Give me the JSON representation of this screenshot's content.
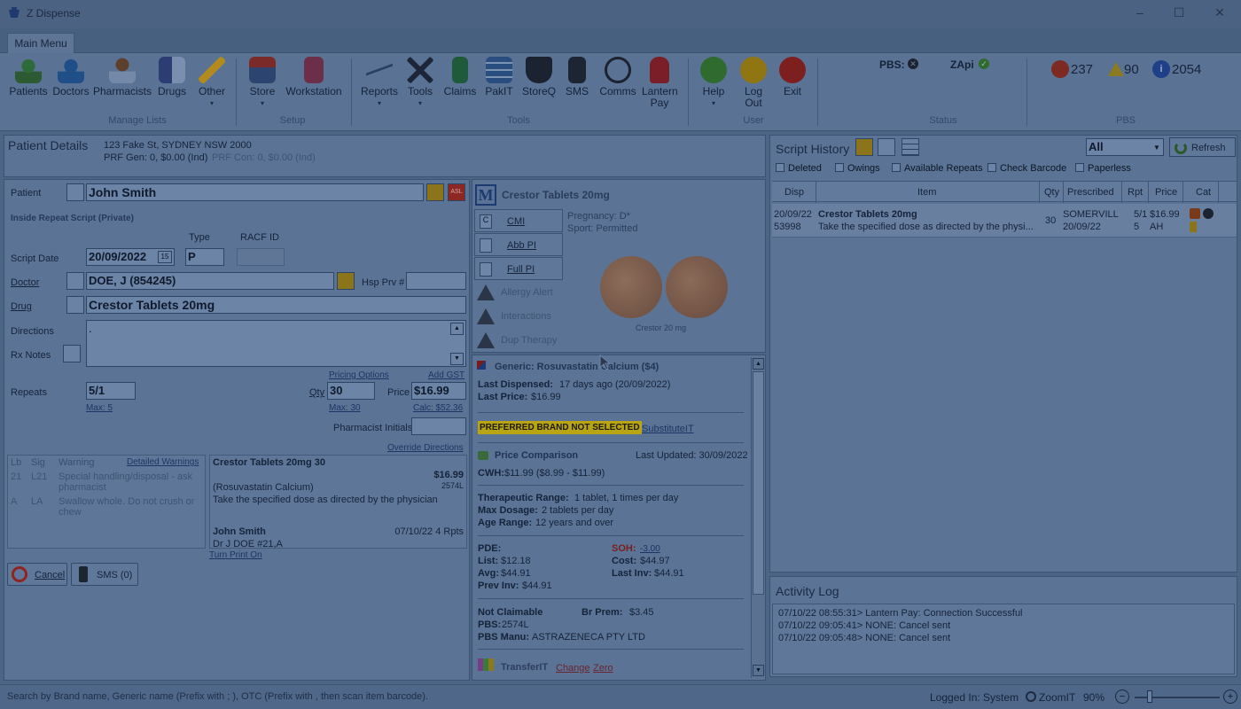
{
  "window": {
    "title": "Z Dispense"
  },
  "ribbon": {
    "tab": "Main Menu",
    "buttons": [
      "Patients",
      "Doctors",
      "Pharmacists",
      "Drugs",
      "Other",
      "Store",
      "Workstation",
      "Reports",
      "Tools",
      "Claims",
      "PakIT",
      "StoreQ",
      "SMS",
      "Comms",
      "Lantern Pay",
      "Help",
      "Log Out",
      "Exit"
    ],
    "groups": [
      "Manage Lists",
      "Setup",
      "Tools",
      "User",
      "Status",
      "PBS"
    ],
    "status": {
      "pbs": "PBS:",
      "zapi": "ZApi"
    },
    "pbs_counts": [
      "237",
      "90",
      "2054"
    ]
  },
  "patient_details": {
    "title": "Patient Details",
    "address": "123 Fake St, SYDNEY NSW 2000",
    "prf_gen": "PRF Gen: 0, $0.00 (Ind)",
    "prf_con": "PRF Con: 0, $0.00 (Ind)"
  },
  "form": {
    "patient_label": "Patient",
    "patient": "John Smith",
    "script_type": "Inside Repeat Script (Private)",
    "type_label": "Type",
    "racf_label": "RACF ID",
    "script_date_label": "Script Date",
    "script_date": "20/09/2022",
    "type": "P",
    "doctor_label": "Doctor",
    "doctor": "DOE, J    (854245)",
    "hsp_label": "Hsp Prv #",
    "drug_label": "Drug",
    "drug": "Crestor Tablets 20mg",
    "directions_label": "Directions",
    "directions": ".",
    "rx_notes_label": "Rx Notes",
    "pricing_options": "Pricing Options",
    "add_gst": "Add GST",
    "repeats_label": "Repeats",
    "repeats": "5/1",
    "max_repeats": "Max: 5",
    "qty_label": "Qty",
    "qty": "30",
    "max_qty": "Max: 30",
    "price_label": "Price",
    "price": "$16.99",
    "calc": "Calc: $52.36",
    "pharmacist_initials_label": "Pharmacist Initials",
    "override_directions": "Override Directions"
  },
  "warnings": {
    "headers": [
      "Lb",
      "Sig",
      "Warning"
    ],
    "detailed": "Detailed Warnings",
    "rows": [
      [
        "21",
        "L21",
        "Special handling/disposal - ask pharmacist"
      ],
      [
        "A",
        "LA",
        "Swallow whole. Do not crush or chew"
      ]
    ]
  },
  "label_preview": {
    "drug": "Crestor Tablets 20mg 30",
    "price": "$16.99",
    "code": "2574L",
    "generic": "(Rosuvastatin Calcium)",
    "directions": "Take the specified dose as directed by the physician",
    "patient": "John Smith",
    "date_rpts": "07/10/22 4 Rpts",
    "doctor": "Dr J DOE  #21,A",
    "turn_print": "Turn Print On"
  },
  "bottom_buttons": {
    "cancel": "Cancel",
    "sms": "SMS (0)"
  },
  "drug_info": {
    "title": "Crestor Tablets 20mg",
    "logo": "M",
    "side_buttons": [
      "CMI",
      "Abb PI",
      "Full PI",
      "Allergy Alert",
      "Interactions",
      "Dup Therapy"
    ],
    "pregnancy": "Pregnancy: D*",
    "sport": "Sport: Permitted",
    "pill_caption": "Crestor 20 mg",
    "generic": "Generic: Rosuvastatin Calcium ($4)",
    "last_dispensed_label": "Last Dispensed:",
    "last_dispensed": "17 days ago (20/09/2022)",
    "last_price_label": "Last Price:",
    "last_price": "$16.99",
    "preferred": "PREFERRED BRAND NOT SELECTED",
    "substitute": "SubstituteIT",
    "price_comparison": "Price Comparison",
    "last_updated": "Last Updated: 30/09/2022",
    "cwh_label": "CWH:",
    "cwh": "$11.99 ($8.99 - $11.99)",
    "therapeutic_label": "Therapeutic Range:",
    "therapeutic": "1 tablet, 1 times per day",
    "max_dosage_label": "Max Dosage:",
    "max_dosage": "2 tablets per day",
    "age_label": "Age Range:",
    "age": "12 years and over",
    "pde": "PDE:",
    "soh_label": "SOH:",
    "soh": "-3.00",
    "list_label": "List:",
    "list": "$12.18",
    "cost_label": "Cost:",
    "cost": "$44.97",
    "avg_label": "Avg:",
    "avg": "$44.91",
    "last_inv_label": "Last Inv:",
    "last_inv": "$44.91",
    "prev_inv_label": "Prev Inv:",
    "prev_inv": "$44.91",
    "not_claimable": "Not Claimable",
    "br_prem_label": "Br Prem:",
    "br_prem": "$3.45",
    "pbs_label": "PBS:",
    "pbs": "2574L",
    "pbs_manu_label": "PBS Manu:",
    "pbs_manu": "ASTRAZENECA PTY LTD",
    "transferit": "TransferIT",
    "change": "Change",
    "zero": "Zero"
  },
  "script_history": {
    "title": "Script History",
    "filter": "All",
    "refresh": "Refresh",
    "checkboxes": [
      "Deleted",
      "Owings",
      "Available Repeats",
      "Check Barcode",
      "Paperless"
    ],
    "columns": [
      "Disp",
      "Item",
      "Qty",
      "Prescribed",
      "Rpt",
      "Price",
      "Cat"
    ],
    "row": {
      "date": "20/09/22",
      "num": "53998",
      "item": "Crestor Tablets 20mg",
      "directions": "Take the specified dose as directed by the physi...",
      "qty": "30",
      "prescriber": "SOMERVILL",
      "prescribed_date": "20/09/22",
      "rpt1": "5/1",
      "rpt2": "5",
      "price": "$16.99",
      "price2": "AH"
    }
  },
  "activity_log": {
    "title": "Activity Log",
    "entries": [
      "07/10/22 08:55:31> Lantern Pay: Connection Successful",
      "07/10/22 09:05:41> NONE: Cancel sent",
      "07/10/22 09:05:48> NONE: Cancel sent"
    ]
  },
  "statusbar": {
    "hint": "Search by Brand name, Generic name (Prefix with ; ), OTC (Prefix with , then scan item barcode).",
    "logged_in": "Logged In: System",
    "zoom_label": "ZoomIT",
    "zoom": "90%"
  },
  "colors": {
    "accent": "#5a7294",
    "warning_bg": "#b9a411",
    "danger": "#a3221d"
  }
}
